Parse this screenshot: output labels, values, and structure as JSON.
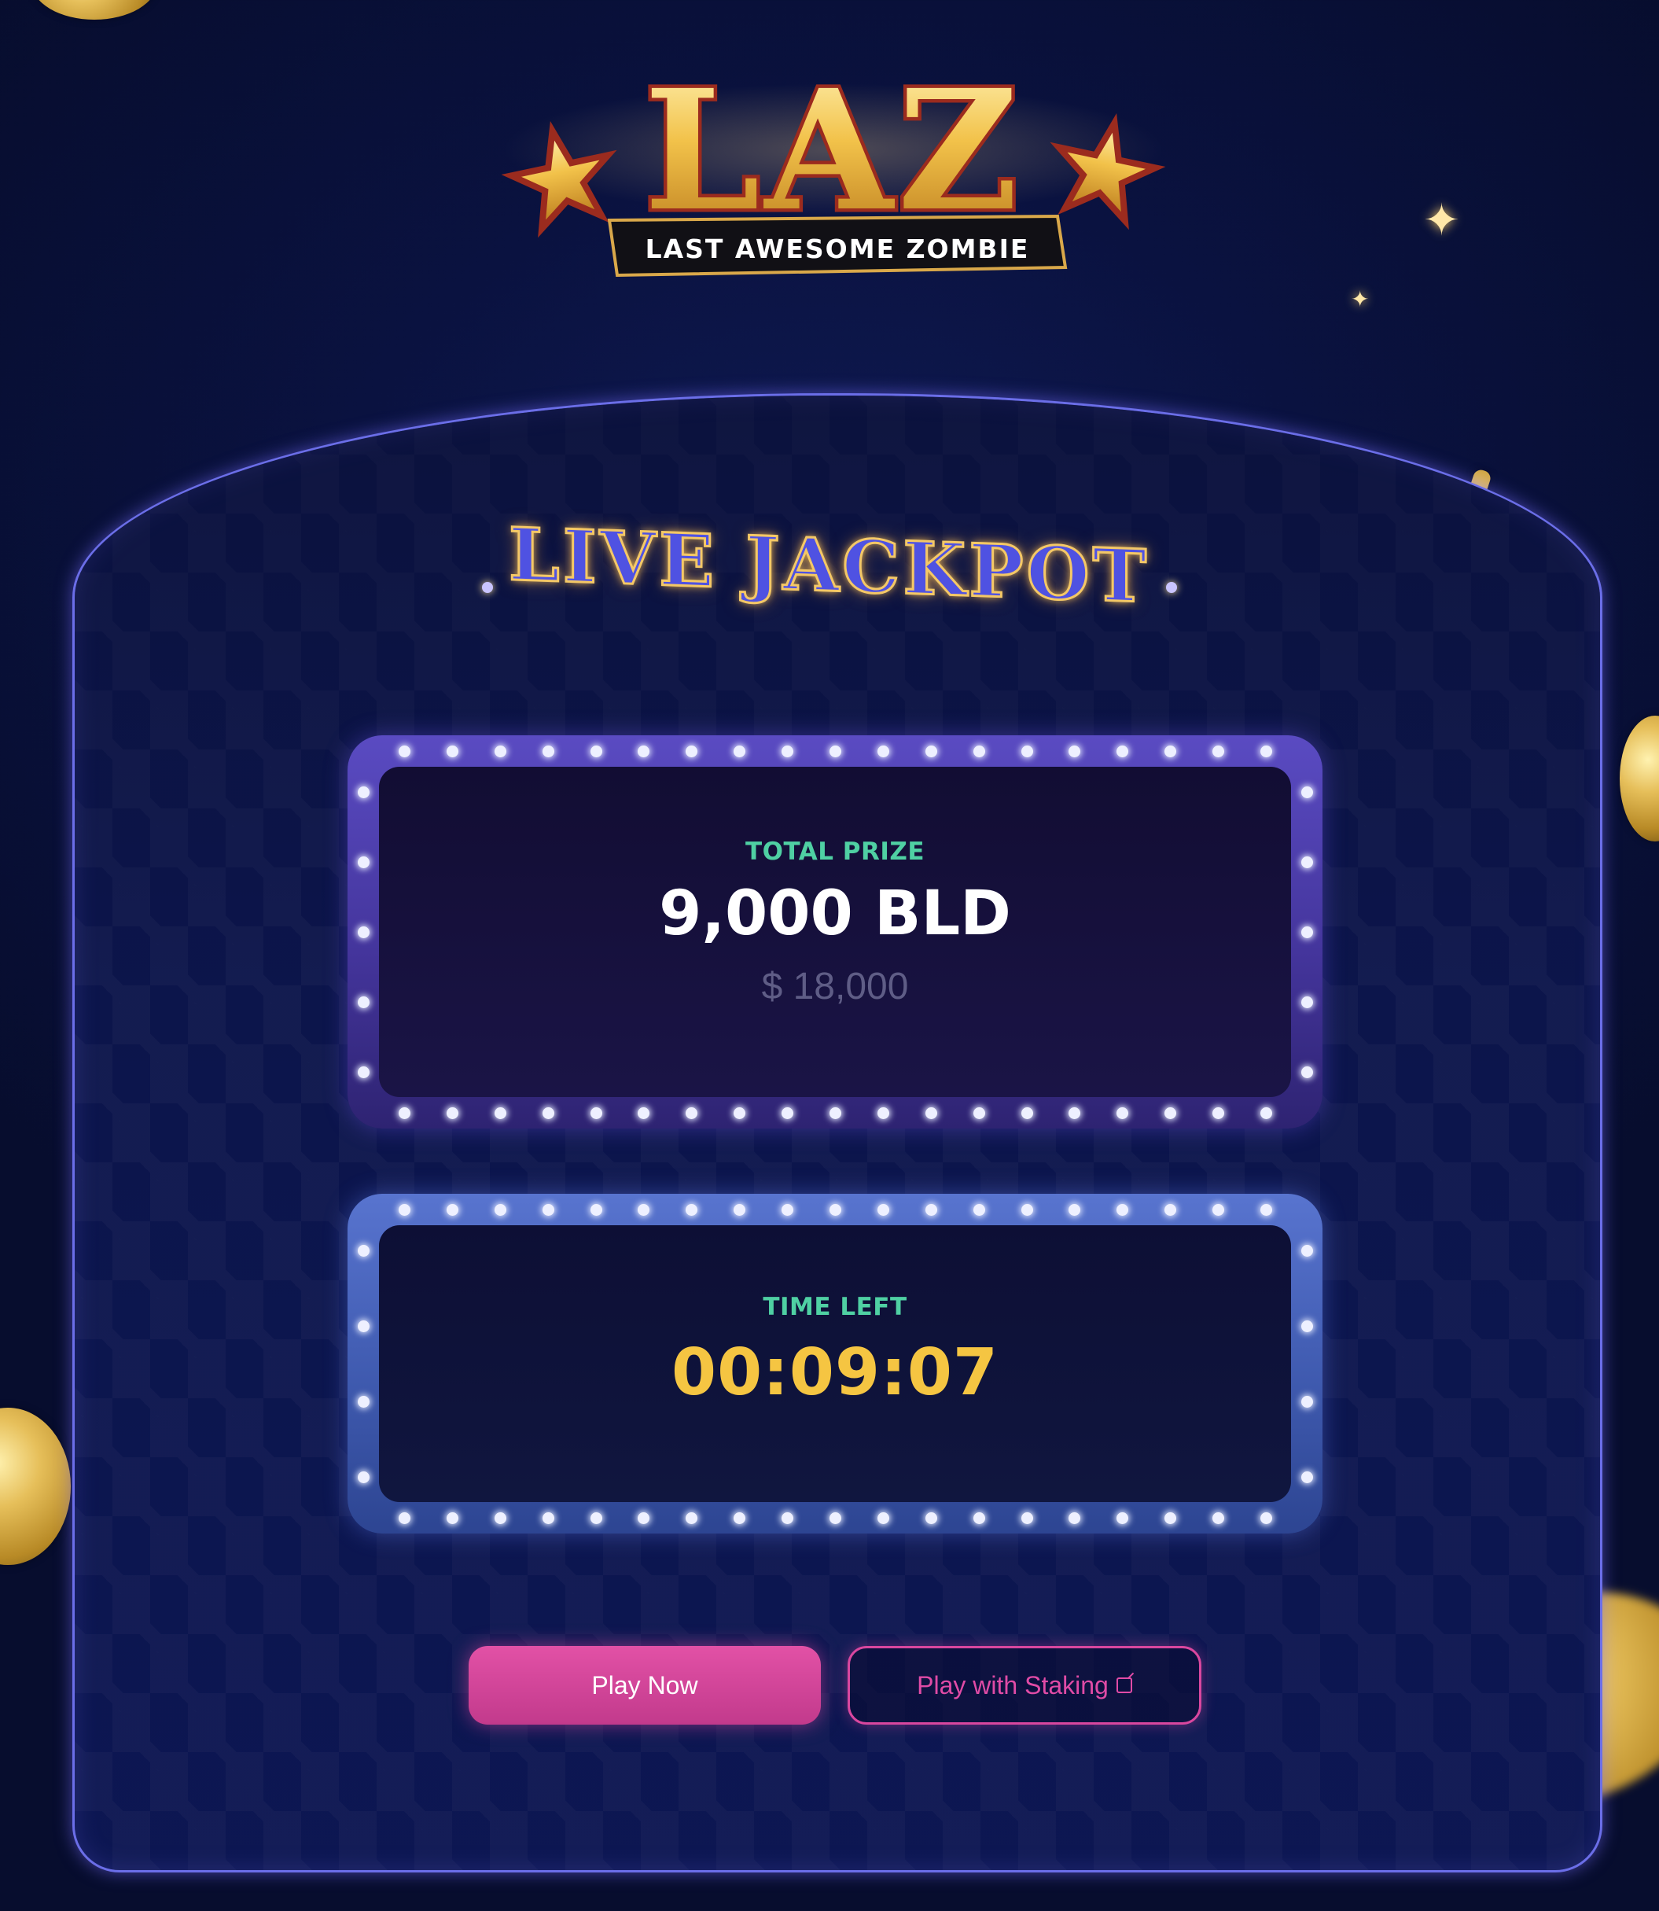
{
  "logo": {
    "main_text": "LAZ",
    "tagline": "LAST AWESOME ZOMBIE"
  },
  "jackpot": {
    "title": "LIVE JACKPOT"
  },
  "prize_panel": {
    "label": "TOTAL PRIZE",
    "amount": "9,000 BLD",
    "usd_value": "$ 18,000"
  },
  "time_panel": {
    "label": "TIME LEFT",
    "countdown": "00:09:07"
  },
  "buttons": {
    "play_now": "Play Now",
    "play_with_staking": "Play with Staking",
    "external_icon": "external-link-icon"
  },
  "colors": {
    "background": "#0a1240",
    "accent_gold": "#f5c542",
    "label_green": "#4fd0a3",
    "primary_pink": "#d9479f",
    "arch_border": "#6b6ee8"
  }
}
